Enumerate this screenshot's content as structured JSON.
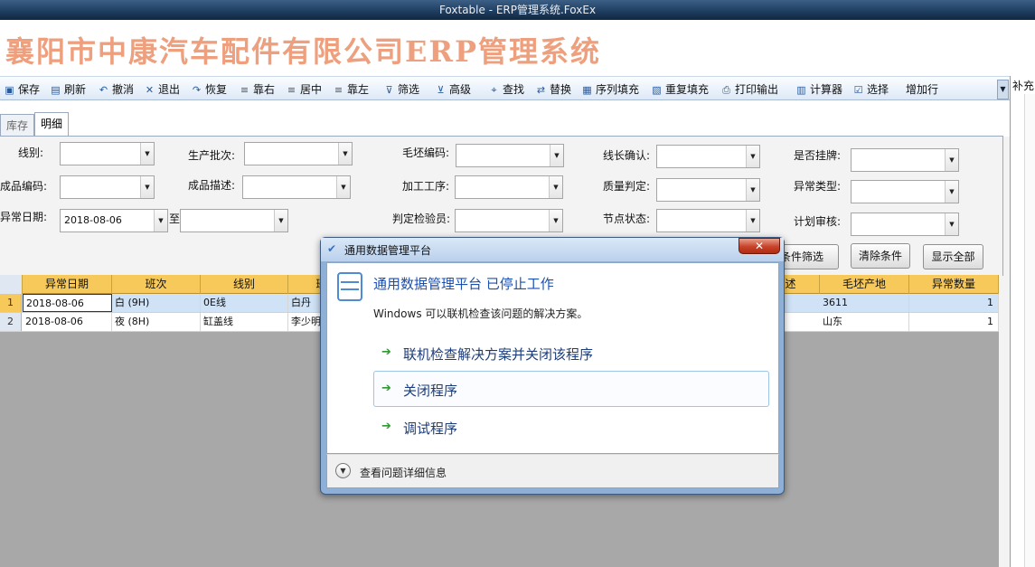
{
  "window": {
    "title": "Foxtable - ERP管理系统.FoxEx"
  },
  "banner": {
    "title": "襄阳市中康汽车配件有限公司ERP管理系统"
  },
  "toolbar": {
    "save": "保存",
    "refresh": "刷新",
    "undo": "撤消",
    "exit": "退出",
    "restore": "恢复",
    "align_right": "靠右",
    "align_center": "居中",
    "align_left": "靠左",
    "filter": "筛选",
    "advanced": "高级",
    "find": "查找",
    "replace": "替换",
    "seq_fill": "序列填充",
    "repeat_fill": "重复填充",
    "print_output": "打印输出",
    "calculator": "计算器",
    "select": "选择",
    "add_row": "增加行"
  },
  "side_panel": {
    "label": "补充"
  },
  "tabs": {
    "inventory": "库存",
    "detail": "明细"
  },
  "filters": {
    "line": "线别:",
    "batch": "生产批次:",
    "blank_code": "毛坯编码:",
    "line_lead_confirm": "线长确认:",
    "listed": "是否挂牌:",
    "product_code": "成品编码:",
    "product_desc": "成品描述:",
    "process": "加工工序:",
    "quality": "质量判定:",
    "abnormal_type": "异常类型:",
    "abnormal_date": "异常日期:",
    "date_from": "2018-08-06",
    "to": "至",
    "inspector": "判定检验员:",
    "node_status": "节点状态:",
    "plan_review": "计划审核:"
  },
  "buttons": {
    "condition_filter": "条件筛选",
    "clear_conditions": "清除条件",
    "show_all": "显示全部"
  },
  "grid": {
    "columns": [
      "异常日期",
      "班次",
      "线别",
      "班组长",
      "毛坯描述",
      "毛坯产地",
      "异常数量"
    ],
    "rows": [
      {
        "num": "1",
        "date": "2018-08-06",
        "shift": "白 (9H)",
        "line": "0E线",
        "leader": "白丹",
        "origin": "3611",
        "qty": "1"
      },
      {
        "num": "2",
        "date": "2018-08-06",
        "shift": "夜 (8H)",
        "line": "缸盖线",
        "leader": "李少明",
        "origin": "山东",
        "qty": "1"
      }
    ]
  },
  "dialog": {
    "title": "通用数据管理平台",
    "heading": "通用数据管理平台 已停止工作",
    "message": "Windows 可以联机检查该问题的解决方案。",
    "options": [
      "联机检查解决方案并关闭该程序",
      "关闭程序",
      "调试程序"
    ],
    "details": "查看问题详细信息",
    "close": "✕"
  }
}
